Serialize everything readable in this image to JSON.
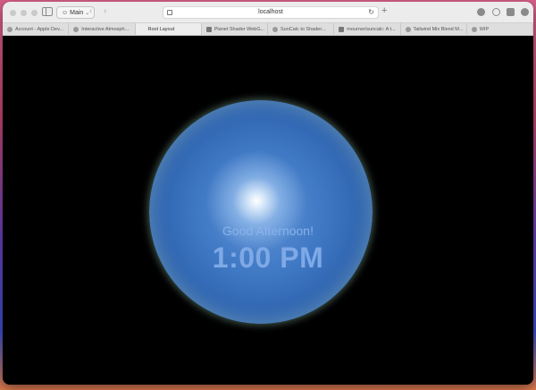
{
  "toolbar": {
    "profile_label": "Main",
    "address": "localhost"
  },
  "tabs": [
    {
      "label": "Account - Apple Dev..."
    },
    {
      "label": "Interactive Atmosph..."
    },
    {
      "label": "Root Layout"
    },
    {
      "label": "Planet Shader WebG..."
    },
    {
      "label": "SunCalc to Shader..."
    },
    {
      "label": "mourner/suncalc: A t..."
    },
    {
      "label": "Tailwind Mix Blend M..."
    },
    {
      "label": "WIP"
    }
  ],
  "active_tab": "Root Layout",
  "main": {
    "greeting": "Good Afternoon!",
    "time": "1:00 PM"
  },
  "colors": {
    "text_accent": "#7fa9e6",
    "orb_core": "#3f78c4"
  }
}
